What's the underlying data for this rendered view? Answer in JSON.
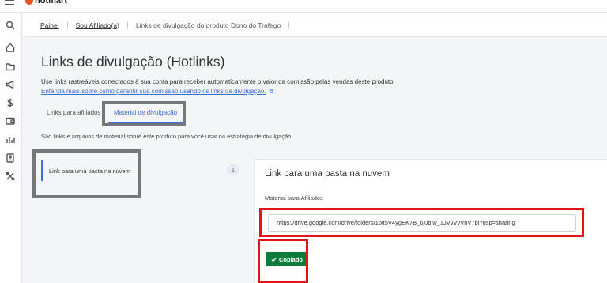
{
  "brand": {
    "logo_text": "hotmart",
    "accent": "#f04e23"
  },
  "breadcrumb": {
    "items": [
      "Painel",
      "Sou Afiliado(a)"
    ],
    "current": "Links de divulgação do produto Dono do Tráfego"
  },
  "page": {
    "title": "Links de divulgação (Hotlinks)",
    "description": "Use links rastreáveis conectados à sua conta para receber automaticamente o valor da comissão pelas vendas deste produto.",
    "learn_link": "Entenda mais sobre como garantir sua comissão usando os links de divulgação."
  },
  "tabs": [
    {
      "label": "Links para afiliados",
      "active": false
    },
    {
      "label": "Material de divulgação",
      "active": true
    }
  ],
  "material": {
    "description": "São links e arquivos de material sobre este produto para você usar na estratégia de divulgação.",
    "list": [
      {
        "label": "Link para uma pasta na nuvem",
        "count": "1"
      }
    ]
  },
  "panel": {
    "title": "Link para uma pasta na nuvem",
    "field_label": "Material para Afiliados",
    "field_value": "https://drive.google.com/drive/folders/1txt5V4ygEK7B_6j0blw_1JVvVvVnV7bl?usp=sharing",
    "button_label": "Copiado",
    "button_color": "#0e7a3c"
  },
  "sidebar": {
    "icons": [
      "search-icon",
      "home-icon",
      "folder-icon",
      "megaphone-icon",
      "dollar-icon",
      "wallet-icon",
      "chart-icon",
      "id-card-icon",
      "tools-icon"
    ]
  },
  "colors": {
    "highlight_red": "#e0141a",
    "highlight_gray": "#777777",
    "link_blue": "#3b6fd8"
  }
}
